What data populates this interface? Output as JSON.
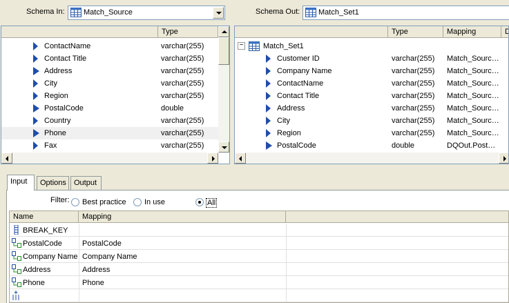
{
  "schema_in": {
    "label": "Schema In:",
    "value": "Match_Source",
    "columns": [
      "",
      "Type"
    ],
    "rows": [
      {
        "name": "ContactName",
        "type": "varchar(255)",
        "icon": "field-arrow-icon"
      },
      {
        "name": "Contact Title",
        "type": "varchar(255)",
        "icon": "field-arrow-icon"
      },
      {
        "name": "Address",
        "type": "varchar(255)",
        "icon": "field-arrow-bold-icon"
      },
      {
        "name": "City",
        "type": "varchar(255)",
        "icon": "field-arrow-icon"
      },
      {
        "name": "Region",
        "type": "varchar(255)",
        "icon": "field-arrow-icon"
      },
      {
        "name": "PostalCode",
        "type": "double",
        "icon": "field-arrow-bold-icon"
      },
      {
        "name": "Country",
        "type": "varchar(255)",
        "icon": "field-arrow-icon"
      },
      {
        "name": "Phone",
        "type": "varchar(255)",
        "icon": "field-arrow-bold-icon"
      },
      {
        "name": "Fax",
        "type": "varchar(255)",
        "icon": "field-arrow-icon"
      }
    ]
  },
  "schema_out": {
    "label": "Schema Out:",
    "value": "Match_Set1",
    "columns": [
      "",
      "Type",
      "Mapping",
      "D"
    ],
    "root": {
      "expander": "−",
      "name": "Match_Set1"
    },
    "rows": [
      {
        "name": "Customer ID",
        "type": "varchar(255)",
        "mapping": "Match_Sourc…",
        "icon": "field-arrow-icon"
      },
      {
        "name": "Company Name",
        "type": "varchar(255)",
        "mapping": "Match_Sourc…",
        "icon": "field-arrow-icon"
      },
      {
        "name": "ContactName",
        "type": "varchar(255)",
        "mapping": "Match_Sourc…",
        "icon": "field-arrow-icon"
      },
      {
        "name": "Contact Title",
        "type": "varchar(255)",
        "mapping": "Match_Sourc…",
        "icon": "field-arrow-icon"
      },
      {
        "name": "Address",
        "type": "varchar(255)",
        "mapping": "Match_Sourc…",
        "icon": "field-arrow-icon"
      },
      {
        "name": "City",
        "type": "varchar(255)",
        "mapping": "Match_Sourc…",
        "icon": "field-arrow-icon"
      },
      {
        "name": "Region",
        "type": "varchar(255)",
        "mapping": "Match_Sourc…",
        "icon": "field-arrow-icon"
      },
      {
        "name": "PostalCode",
        "type": "double",
        "mapping": "DQOut.Post…",
        "icon": "field-arrow-bold-icon"
      }
    ]
  },
  "tabs": [
    "Input",
    "Options",
    "Output"
  ],
  "active_tab": "Input",
  "filter": {
    "label": "Filter:",
    "options": [
      "Best practice",
      "In use",
      "All"
    ],
    "selected": "All"
  },
  "grid": {
    "columns": [
      "Name",
      "Mapping"
    ],
    "rows": [
      {
        "name": "BREAK_KEY",
        "mapping": "",
        "icon": "key-column-icon"
      },
      {
        "name": "PostalCode",
        "mapping": "PostalCode",
        "icon": "mapped-field-icon"
      },
      {
        "name": "Company Name",
        "mapping": "Company Name",
        "icon": "mapped-field-icon"
      },
      {
        "name": "Address",
        "mapping": "Address",
        "icon": "mapped-field-icon"
      },
      {
        "name": "Phone",
        "mapping": "Phone",
        "icon": "mapped-field-icon"
      },
      {
        "name": "",
        "mapping": "",
        "icon": "new-row-icon"
      }
    ]
  },
  "colors": {
    "background": "#ece9d8",
    "border": "#7f9db9",
    "arrow": "#1f4ea8",
    "mapped_icon": "#2d8a2d"
  }
}
